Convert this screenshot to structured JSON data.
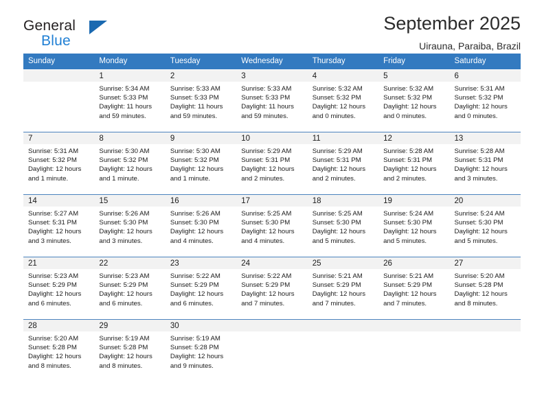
{
  "brand": {
    "name_top": "General",
    "name_bottom": "Blue",
    "logo_icon": "triangle-logo-icon",
    "accent_color": "#1a69b0",
    "blue_text_color": "#1f7fd4"
  },
  "header": {
    "title": "September 2025",
    "subtitle": "Uirauna, Paraiba, Brazil"
  },
  "theme": {
    "header_bar_color": "#337ac0",
    "day_band_color": "#f2f2f2",
    "week_separator_color": "#4a82bd"
  },
  "weekday_headers": [
    "Sunday",
    "Monday",
    "Tuesday",
    "Wednesday",
    "Thursday",
    "Friday",
    "Saturday"
  ],
  "weeks": [
    [
      {
        "day": "",
        "sunrise": "",
        "sunset": "",
        "daylight_line1": "",
        "daylight_line2": "",
        "empty": true
      },
      {
        "day": "1",
        "sunrise": "Sunrise: 5:34 AM",
        "sunset": "Sunset: 5:33 PM",
        "daylight_line1": "Daylight: 11 hours",
        "daylight_line2": "and 59 minutes."
      },
      {
        "day": "2",
        "sunrise": "Sunrise: 5:33 AM",
        "sunset": "Sunset: 5:33 PM",
        "daylight_line1": "Daylight: 11 hours",
        "daylight_line2": "and 59 minutes."
      },
      {
        "day": "3",
        "sunrise": "Sunrise: 5:33 AM",
        "sunset": "Sunset: 5:33 PM",
        "daylight_line1": "Daylight: 11 hours",
        "daylight_line2": "and 59 minutes."
      },
      {
        "day": "4",
        "sunrise": "Sunrise: 5:32 AM",
        "sunset": "Sunset: 5:32 PM",
        "daylight_line1": "Daylight: 12 hours",
        "daylight_line2": "and 0 minutes."
      },
      {
        "day": "5",
        "sunrise": "Sunrise: 5:32 AM",
        "sunset": "Sunset: 5:32 PM",
        "daylight_line1": "Daylight: 12 hours",
        "daylight_line2": "and 0 minutes."
      },
      {
        "day": "6",
        "sunrise": "Sunrise: 5:31 AM",
        "sunset": "Sunset: 5:32 PM",
        "daylight_line1": "Daylight: 12 hours",
        "daylight_line2": "and 0 minutes."
      }
    ],
    [
      {
        "day": "7",
        "sunrise": "Sunrise: 5:31 AM",
        "sunset": "Sunset: 5:32 PM",
        "daylight_line1": "Daylight: 12 hours",
        "daylight_line2": "and 1 minute."
      },
      {
        "day": "8",
        "sunrise": "Sunrise: 5:30 AM",
        "sunset": "Sunset: 5:32 PM",
        "daylight_line1": "Daylight: 12 hours",
        "daylight_line2": "and 1 minute."
      },
      {
        "day": "9",
        "sunrise": "Sunrise: 5:30 AM",
        "sunset": "Sunset: 5:32 PM",
        "daylight_line1": "Daylight: 12 hours",
        "daylight_line2": "and 1 minute."
      },
      {
        "day": "10",
        "sunrise": "Sunrise: 5:29 AM",
        "sunset": "Sunset: 5:31 PM",
        "daylight_line1": "Daylight: 12 hours",
        "daylight_line2": "and 2 minutes."
      },
      {
        "day": "11",
        "sunrise": "Sunrise: 5:29 AM",
        "sunset": "Sunset: 5:31 PM",
        "daylight_line1": "Daylight: 12 hours",
        "daylight_line2": "and 2 minutes."
      },
      {
        "day": "12",
        "sunrise": "Sunrise: 5:28 AM",
        "sunset": "Sunset: 5:31 PM",
        "daylight_line1": "Daylight: 12 hours",
        "daylight_line2": "and 2 minutes."
      },
      {
        "day": "13",
        "sunrise": "Sunrise: 5:28 AM",
        "sunset": "Sunset: 5:31 PM",
        "daylight_line1": "Daylight: 12 hours",
        "daylight_line2": "and 3 minutes."
      }
    ],
    [
      {
        "day": "14",
        "sunrise": "Sunrise: 5:27 AM",
        "sunset": "Sunset: 5:31 PM",
        "daylight_line1": "Daylight: 12 hours",
        "daylight_line2": "and 3 minutes."
      },
      {
        "day": "15",
        "sunrise": "Sunrise: 5:26 AM",
        "sunset": "Sunset: 5:30 PM",
        "daylight_line1": "Daylight: 12 hours",
        "daylight_line2": "and 3 minutes."
      },
      {
        "day": "16",
        "sunrise": "Sunrise: 5:26 AM",
        "sunset": "Sunset: 5:30 PM",
        "daylight_line1": "Daylight: 12 hours",
        "daylight_line2": "and 4 minutes."
      },
      {
        "day": "17",
        "sunrise": "Sunrise: 5:25 AM",
        "sunset": "Sunset: 5:30 PM",
        "daylight_line1": "Daylight: 12 hours",
        "daylight_line2": "and 4 minutes."
      },
      {
        "day": "18",
        "sunrise": "Sunrise: 5:25 AM",
        "sunset": "Sunset: 5:30 PM",
        "daylight_line1": "Daylight: 12 hours",
        "daylight_line2": "and 5 minutes."
      },
      {
        "day": "19",
        "sunrise": "Sunrise: 5:24 AM",
        "sunset": "Sunset: 5:30 PM",
        "daylight_line1": "Daylight: 12 hours",
        "daylight_line2": "and 5 minutes."
      },
      {
        "day": "20",
        "sunrise": "Sunrise: 5:24 AM",
        "sunset": "Sunset: 5:30 PM",
        "daylight_line1": "Daylight: 12 hours",
        "daylight_line2": "and 5 minutes."
      }
    ],
    [
      {
        "day": "21",
        "sunrise": "Sunrise: 5:23 AM",
        "sunset": "Sunset: 5:29 PM",
        "daylight_line1": "Daylight: 12 hours",
        "daylight_line2": "and 6 minutes."
      },
      {
        "day": "22",
        "sunrise": "Sunrise: 5:23 AM",
        "sunset": "Sunset: 5:29 PM",
        "daylight_line1": "Daylight: 12 hours",
        "daylight_line2": "and 6 minutes."
      },
      {
        "day": "23",
        "sunrise": "Sunrise: 5:22 AM",
        "sunset": "Sunset: 5:29 PM",
        "daylight_line1": "Daylight: 12 hours",
        "daylight_line2": "and 6 minutes."
      },
      {
        "day": "24",
        "sunrise": "Sunrise: 5:22 AM",
        "sunset": "Sunset: 5:29 PM",
        "daylight_line1": "Daylight: 12 hours",
        "daylight_line2": "and 7 minutes."
      },
      {
        "day": "25",
        "sunrise": "Sunrise: 5:21 AM",
        "sunset": "Sunset: 5:29 PM",
        "daylight_line1": "Daylight: 12 hours",
        "daylight_line2": "and 7 minutes."
      },
      {
        "day": "26",
        "sunrise": "Sunrise: 5:21 AM",
        "sunset": "Sunset: 5:29 PM",
        "daylight_line1": "Daylight: 12 hours",
        "daylight_line2": "and 7 minutes."
      },
      {
        "day": "27",
        "sunrise": "Sunrise: 5:20 AM",
        "sunset": "Sunset: 5:28 PM",
        "daylight_line1": "Daylight: 12 hours",
        "daylight_line2": "and 8 minutes."
      }
    ],
    [
      {
        "day": "28",
        "sunrise": "Sunrise: 5:20 AM",
        "sunset": "Sunset: 5:28 PM",
        "daylight_line1": "Daylight: 12 hours",
        "daylight_line2": "and 8 minutes."
      },
      {
        "day": "29",
        "sunrise": "Sunrise: 5:19 AM",
        "sunset": "Sunset: 5:28 PM",
        "daylight_line1": "Daylight: 12 hours",
        "daylight_line2": "and 8 minutes."
      },
      {
        "day": "30",
        "sunrise": "Sunrise: 5:19 AM",
        "sunset": "Sunset: 5:28 PM",
        "daylight_line1": "Daylight: 12 hours",
        "daylight_line2": "and 9 minutes."
      },
      {
        "day": "",
        "sunrise": "",
        "sunset": "",
        "daylight_line1": "",
        "daylight_line2": "",
        "empty": true
      },
      {
        "day": "",
        "sunrise": "",
        "sunset": "",
        "daylight_line1": "",
        "daylight_line2": "",
        "empty": true
      },
      {
        "day": "",
        "sunrise": "",
        "sunset": "",
        "daylight_line1": "",
        "daylight_line2": "",
        "empty": true
      },
      {
        "day": "",
        "sunrise": "",
        "sunset": "",
        "daylight_line1": "",
        "daylight_line2": "",
        "empty": true
      }
    ]
  ]
}
